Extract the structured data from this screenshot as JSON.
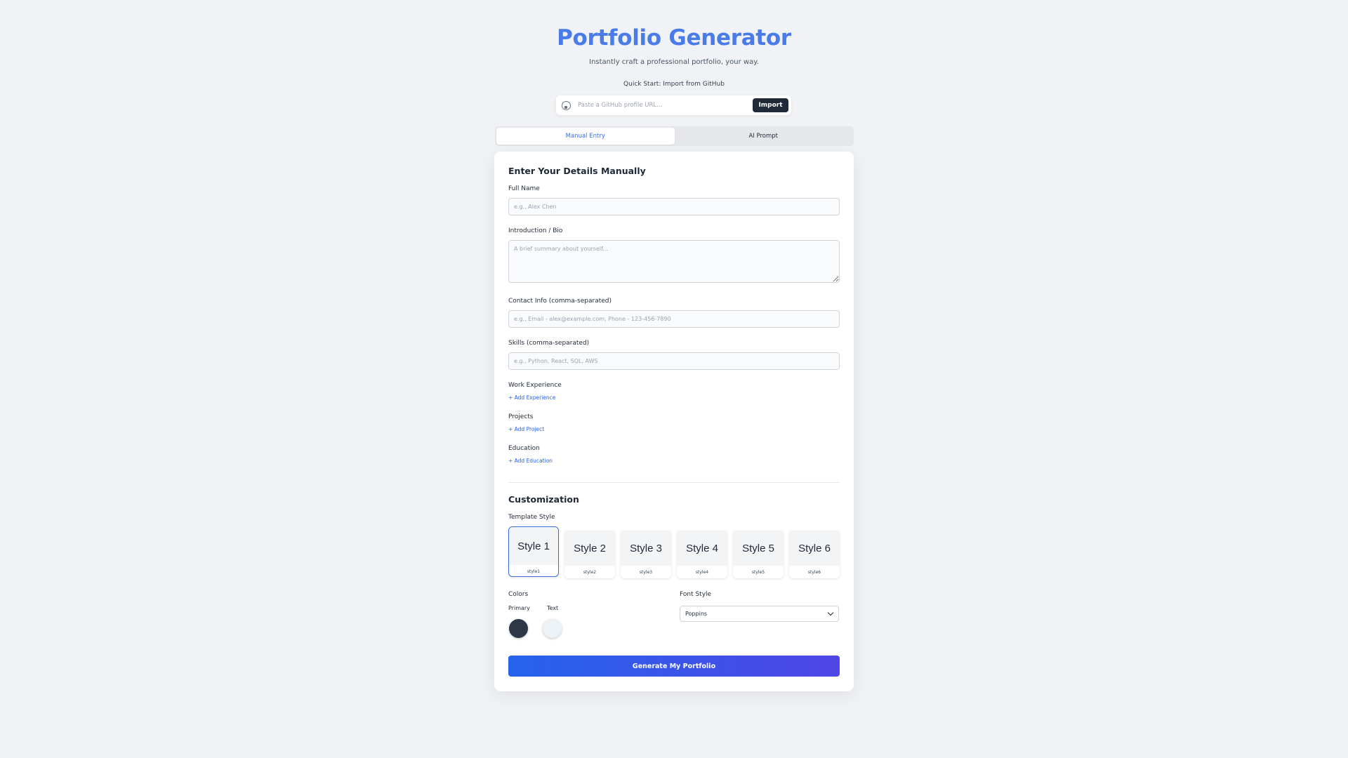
{
  "header": {
    "title": "Portfolio Generator",
    "subtitle": "Instantly craft a professional portfolio, your way."
  },
  "github": {
    "label": "Quick Start: Import from GitHub",
    "placeholder": "Paste a GitHub profile URL...",
    "value": "",
    "button_label": "Import",
    "icon": "github-icon"
  },
  "tabs": [
    {
      "label": "Manual Entry",
      "active": true
    },
    {
      "label": "AI Prompt",
      "active": false
    }
  ],
  "form": {
    "heading": "Enter Your Details Manually",
    "full_name": {
      "label": "Full Name",
      "placeholder": "e.g., Alex Chen",
      "value": ""
    },
    "bio": {
      "label": "Introduction / Bio",
      "placeholder": "A brief summary about yourself...",
      "value": ""
    },
    "contact": {
      "label": "Contact Info (comma-separated)",
      "placeholder": "e.g., Email - alex@example.com, Phone - 123-456-7890",
      "value": ""
    },
    "skills": {
      "label": "Skills (comma-separated)",
      "placeholder": "e.g., Python, React, SQL, AWS",
      "value": ""
    },
    "work": {
      "label": "Work Experience",
      "add_label": "+ Add Experience"
    },
    "projects": {
      "label": "Projects",
      "add_label": "+ Add Project"
    },
    "education": {
      "label": "Education",
      "add_label": "+ Add Education"
    }
  },
  "customization": {
    "heading": "Customization",
    "template_label": "Template Style",
    "templates": [
      {
        "preview": "Style 1",
        "name": "style1",
        "selected": true
      },
      {
        "preview": "Style 2",
        "name": "style2",
        "selected": false
      },
      {
        "preview": "Style 3",
        "name": "style3",
        "selected": false
      },
      {
        "preview": "Style 4",
        "name": "style4",
        "selected": false
      },
      {
        "preview": "Style 5",
        "name": "style5",
        "selected": false
      },
      {
        "preview": "Style 6",
        "name": "style6",
        "selected": false
      }
    ],
    "colors_label": "Colors",
    "primary_label": "Primary",
    "primary_color": "#2d3748",
    "text_label": "Text",
    "text_color": "#edf2f7",
    "font_label": "Font Style",
    "font_value": "Poppins"
  },
  "generate_label": "Generate My Portfolio",
  "theme": {
    "accent": "#4a7bea",
    "button_dark": "#1f2937",
    "gradient_start": "#2563eb",
    "gradient_end": "#4f46e5"
  }
}
